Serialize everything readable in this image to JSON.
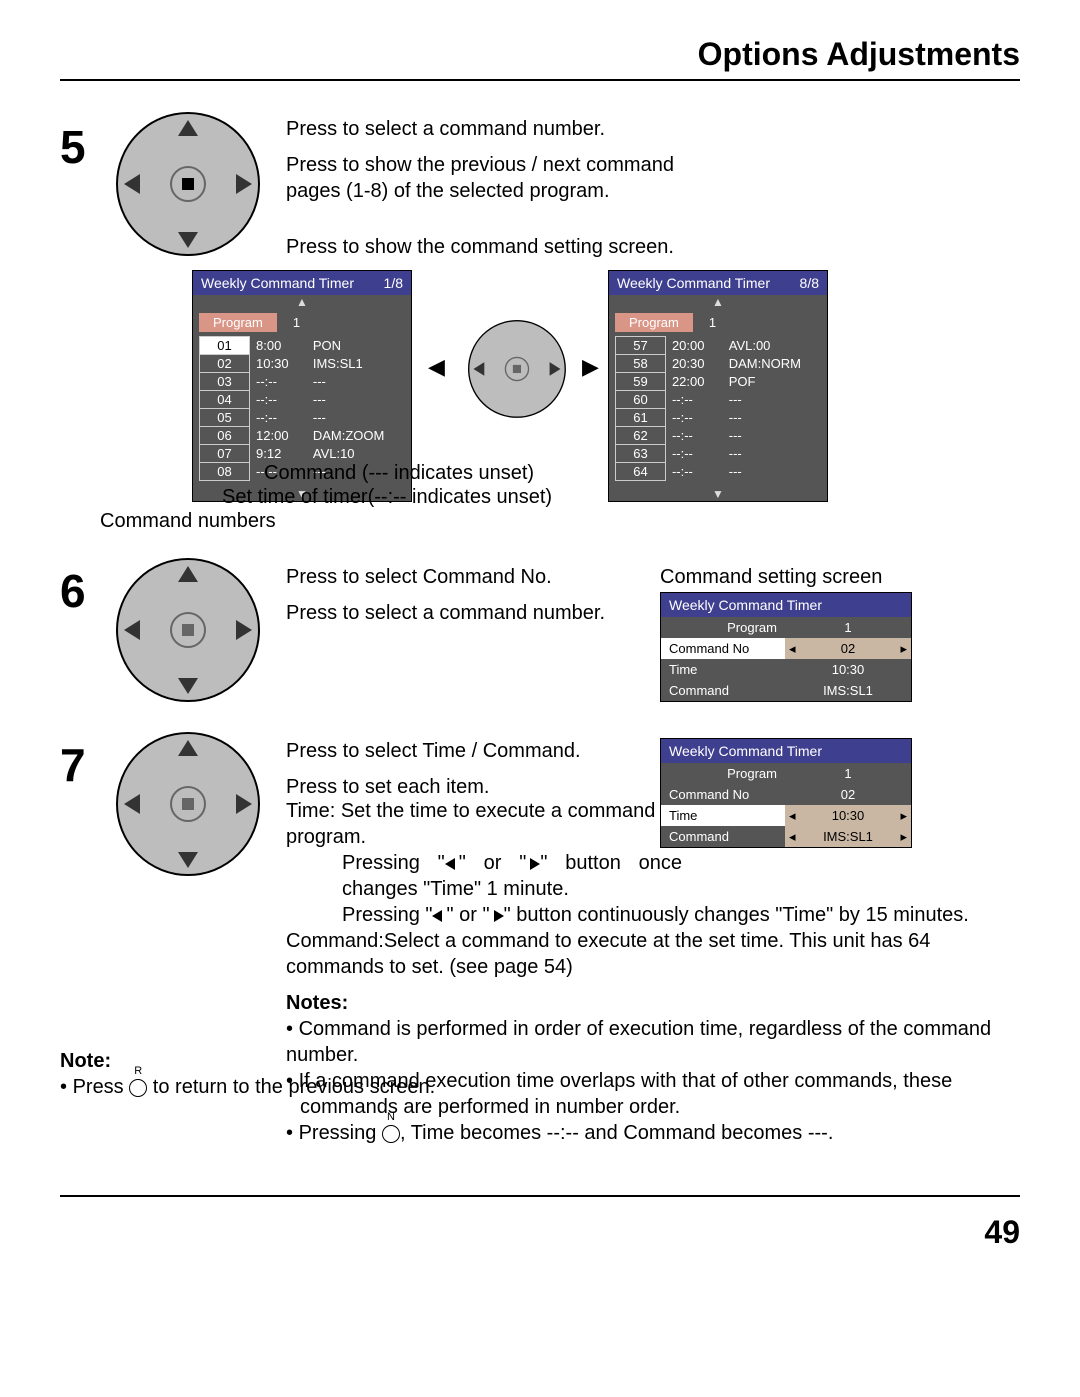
{
  "header": {
    "title": "Options Adjustments"
  },
  "page_number": "49",
  "step5": {
    "line1": "Press to select a command number.",
    "line2": "Press to show the previous / next command pages (1-8) of the selected program.",
    "line3": "Press to show the command setting screen.",
    "caption_command": "Command (--- indicates unset)",
    "caption_settime": "Set time of timer(--:-- indicates unset)",
    "caption_numbers": "Command numbers"
  },
  "wct_left": {
    "title": "Weekly Command Timer",
    "page": "1/8",
    "program_label": "Program",
    "program_value": "1",
    "rows": [
      {
        "n": "01",
        "sel": true,
        "t": "8:00",
        "c": "PON"
      },
      {
        "n": "02",
        "sel": false,
        "t": "10:30",
        "c": "IMS:SL1"
      },
      {
        "n": "03",
        "sel": false,
        "t": "--:--",
        "c": "---"
      },
      {
        "n": "04",
        "sel": false,
        "t": "--:--",
        "c": "---"
      },
      {
        "n": "05",
        "sel": false,
        "t": "--:--",
        "c": "---"
      },
      {
        "n": "06",
        "sel": false,
        "t": "12:00",
        "c": "DAM:ZOOM"
      },
      {
        "n": "07",
        "sel": false,
        "t": "9:12",
        "c": "AVL:10"
      },
      {
        "n": "08",
        "sel": false,
        "t": "--:--",
        "c": "---"
      }
    ]
  },
  "wct_right": {
    "title": "Weekly Command Timer",
    "page": "8/8",
    "program_label": "Program",
    "program_value": "1",
    "rows": [
      {
        "n": "57",
        "sel": false,
        "t": "20:00",
        "c": "AVL:00"
      },
      {
        "n": "58",
        "sel": false,
        "t": "20:30",
        "c": "DAM:NORM"
      },
      {
        "n": "59",
        "sel": false,
        "t": "22:00",
        "c": "POF"
      },
      {
        "n": "60",
        "sel": false,
        "t": "--:--",
        "c": "---"
      },
      {
        "n": "61",
        "sel": false,
        "t": "--:--",
        "c": "---"
      },
      {
        "n": "62",
        "sel": false,
        "t": "--:--",
        "c": "---"
      },
      {
        "n": "63",
        "sel": false,
        "t": "--:--",
        "c": "---"
      },
      {
        "n": "64",
        "sel": false,
        "t": "--:--",
        "c": "---"
      }
    ]
  },
  "step6": {
    "heading": "Command setting screen",
    "line1": "Press to select Command No.",
    "line2": "Press to select a command number."
  },
  "css1": {
    "title": "Weekly Command Timer",
    "program_label": "Program",
    "program_value": "1",
    "rows": [
      {
        "k": "Command No",
        "v": "02",
        "sel": true,
        "arrows": true
      },
      {
        "k": "Time",
        "v": "10:30",
        "sel": false,
        "arrows": false
      },
      {
        "k": "Command",
        "v": "IMS:SL1",
        "sel": false,
        "arrows": false
      }
    ]
  },
  "step7": {
    "line1": "Press to select Time / Command.",
    "line2": "Press to set each item.",
    "time_label": "Time: Set the time to execute a command program.",
    "time_detail1a": "Pressing \"",
    "time_detail1b": "\" or \"",
    "time_detail1c": "\" button once changes \"Time\" 1 minute.",
    "time_detail2a": "Pressing \"",
    "time_detail2b": "\" or \"",
    "time_detail2c": "\" button continuously changes \"Time\" by 15 minutes.",
    "command_label": "Command:Select a command to execute at the set time. This unit has 64 commands to set. (see page 54)",
    "notes_heading": "Notes:",
    "note1": "Command is performed in order of execution time, regardless of the command number.",
    "note2": "If a command execution time overlaps with that of other commands, these commands are performed in number order.",
    "note3a": "Pressing ",
    "note3b": ", Time becomes --:-- and Command becomes ---."
  },
  "css2": {
    "title": "Weekly Command Timer",
    "program_label": "Program",
    "program_value": "1",
    "rows": [
      {
        "k": "Command No",
        "v": "02",
        "sel": false,
        "arrows": false
      },
      {
        "k": "Time",
        "v": "10:30",
        "sel": true,
        "arrows": true
      },
      {
        "k": "Command",
        "v": "IMS:SL1",
        "sel": false,
        "arrows": true
      }
    ]
  },
  "bottom_note": {
    "heading": "Note:",
    "text_a": "Press ",
    "text_b": " to return to the previous screen."
  }
}
